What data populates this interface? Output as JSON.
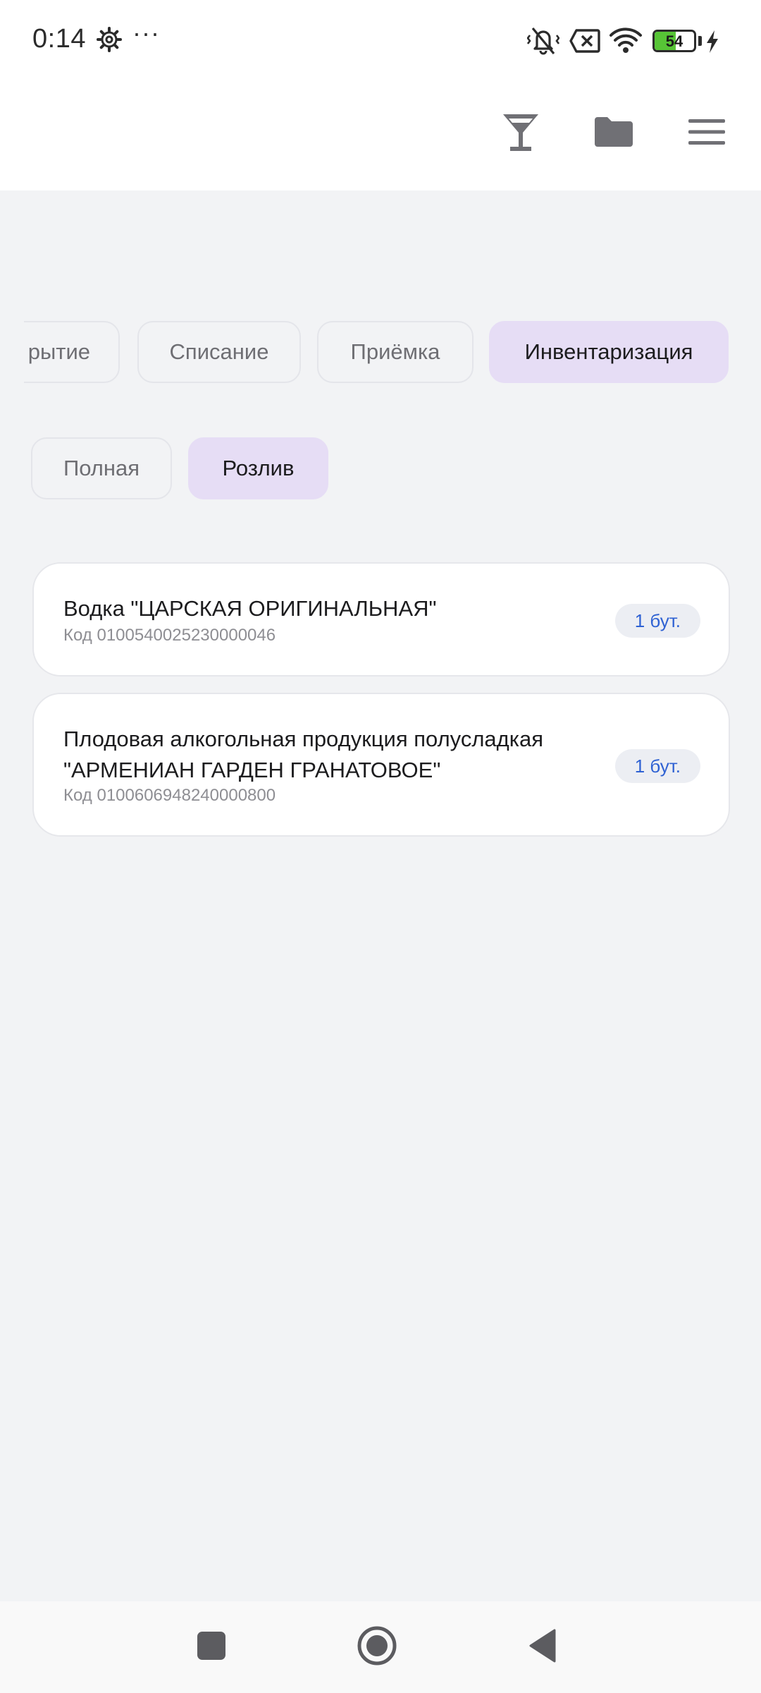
{
  "status_bar": {
    "time": "0:14",
    "more": "···",
    "battery_level": 54,
    "battery_text": "54",
    "icons": [
      "settings-gear-icon",
      "mute-vibrate-icon",
      "no-sim-icon",
      "wifi-icon",
      "battery-icon",
      "charging-icon"
    ]
  },
  "app_bar": {
    "icons": [
      "cocktail-glass-icon",
      "folder-icon",
      "menu-icon"
    ]
  },
  "tabs": [
    {
      "label": "рытие",
      "active": false
    },
    {
      "label": "Списание",
      "active": false
    },
    {
      "label": "Приёмка",
      "active": false
    },
    {
      "label": "Инвентаризация",
      "active": true
    }
  ],
  "subtabs": [
    {
      "label": "Полная",
      "active": false
    },
    {
      "label": "Розлив",
      "active": true
    }
  ],
  "items": [
    {
      "title": "Водка \"ЦАРСКАЯ ОРИГИНАЛЬНАЯ\"",
      "code": "Код 0100540025230000046",
      "qty": "1 бут."
    },
    {
      "title": "Плодовая алкогольная продукция полусладкая \"АРМЕНИАН ГАРДЕН ГРАНАТОВОЕ\"",
      "code": "Код 0100606948240000800",
      "qty": "1 бут."
    }
  ],
  "nav_bar": {
    "icons": [
      "recents-square-icon",
      "home-circle-icon",
      "back-triangle-icon"
    ]
  },
  "colors": {
    "accent_chip": "#E6DDF5",
    "qty_text": "#2F62D3",
    "background": "#F2F3F5",
    "battery": "#57C436"
  }
}
